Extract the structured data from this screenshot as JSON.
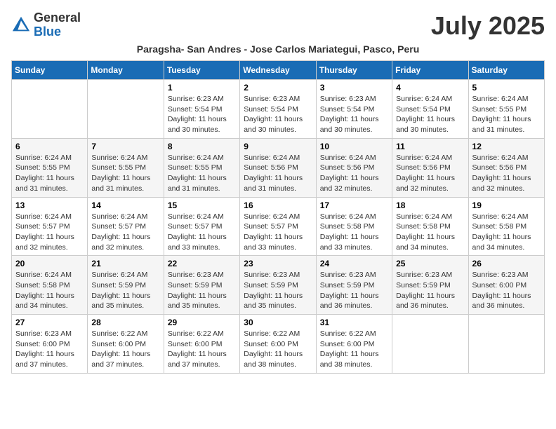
{
  "header": {
    "logo_general": "General",
    "logo_blue": "Blue",
    "month_title": "July 2025",
    "subtitle": "Paragsha- San Andres - Jose Carlos Mariategui, Pasco, Peru"
  },
  "days_of_week": [
    "Sunday",
    "Monday",
    "Tuesday",
    "Wednesday",
    "Thursday",
    "Friday",
    "Saturday"
  ],
  "weeks": [
    [
      {
        "day": "",
        "sunrise": "",
        "sunset": "",
        "daylight": ""
      },
      {
        "day": "",
        "sunrise": "",
        "sunset": "",
        "daylight": ""
      },
      {
        "day": "1",
        "sunrise": "Sunrise: 6:23 AM",
        "sunset": "Sunset: 5:54 PM",
        "daylight": "Daylight: 11 hours and 30 minutes."
      },
      {
        "day": "2",
        "sunrise": "Sunrise: 6:23 AM",
        "sunset": "Sunset: 5:54 PM",
        "daylight": "Daylight: 11 hours and 30 minutes."
      },
      {
        "day": "3",
        "sunrise": "Sunrise: 6:23 AM",
        "sunset": "Sunset: 5:54 PM",
        "daylight": "Daylight: 11 hours and 30 minutes."
      },
      {
        "day": "4",
        "sunrise": "Sunrise: 6:24 AM",
        "sunset": "Sunset: 5:54 PM",
        "daylight": "Daylight: 11 hours and 30 minutes."
      },
      {
        "day": "5",
        "sunrise": "Sunrise: 6:24 AM",
        "sunset": "Sunset: 5:55 PM",
        "daylight": "Daylight: 11 hours and 31 minutes."
      }
    ],
    [
      {
        "day": "6",
        "sunrise": "Sunrise: 6:24 AM",
        "sunset": "Sunset: 5:55 PM",
        "daylight": "Daylight: 11 hours and 31 minutes."
      },
      {
        "day": "7",
        "sunrise": "Sunrise: 6:24 AM",
        "sunset": "Sunset: 5:55 PM",
        "daylight": "Daylight: 11 hours and 31 minutes."
      },
      {
        "day": "8",
        "sunrise": "Sunrise: 6:24 AM",
        "sunset": "Sunset: 5:55 PM",
        "daylight": "Daylight: 11 hours and 31 minutes."
      },
      {
        "day": "9",
        "sunrise": "Sunrise: 6:24 AM",
        "sunset": "Sunset: 5:56 PM",
        "daylight": "Daylight: 11 hours and 31 minutes."
      },
      {
        "day": "10",
        "sunrise": "Sunrise: 6:24 AM",
        "sunset": "Sunset: 5:56 PM",
        "daylight": "Daylight: 11 hours and 32 minutes."
      },
      {
        "day": "11",
        "sunrise": "Sunrise: 6:24 AM",
        "sunset": "Sunset: 5:56 PM",
        "daylight": "Daylight: 11 hours and 32 minutes."
      },
      {
        "day": "12",
        "sunrise": "Sunrise: 6:24 AM",
        "sunset": "Sunset: 5:56 PM",
        "daylight": "Daylight: 11 hours and 32 minutes."
      }
    ],
    [
      {
        "day": "13",
        "sunrise": "Sunrise: 6:24 AM",
        "sunset": "Sunset: 5:57 PM",
        "daylight": "Daylight: 11 hours and 32 minutes."
      },
      {
        "day": "14",
        "sunrise": "Sunrise: 6:24 AM",
        "sunset": "Sunset: 5:57 PM",
        "daylight": "Daylight: 11 hours and 32 minutes."
      },
      {
        "day": "15",
        "sunrise": "Sunrise: 6:24 AM",
        "sunset": "Sunset: 5:57 PM",
        "daylight": "Daylight: 11 hours and 33 minutes."
      },
      {
        "day": "16",
        "sunrise": "Sunrise: 6:24 AM",
        "sunset": "Sunset: 5:57 PM",
        "daylight": "Daylight: 11 hours and 33 minutes."
      },
      {
        "day": "17",
        "sunrise": "Sunrise: 6:24 AM",
        "sunset": "Sunset: 5:58 PM",
        "daylight": "Daylight: 11 hours and 33 minutes."
      },
      {
        "day": "18",
        "sunrise": "Sunrise: 6:24 AM",
        "sunset": "Sunset: 5:58 PM",
        "daylight": "Daylight: 11 hours and 34 minutes."
      },
      {
        "day": "19",
        "sunrise": "Sunrise: 6:24 AM",
        "sunset": "Sunset: 5:58 PM",
        "daylight": "Daylight: 11 hours and 34 minutes."
      }
    ],
    [
      {
        "day": "20",
        "sunrise": "Sunrise: 6:24 AM",
        "sunset": "Sunset: 5:58 PM",
        "daylight": "Daylight: 11 hours and 34 minutes."
      },
      {
        "day": "21",
        "sunrise": "Sunrise: 6:24 AM",
        "sunset": "Sunset: 5:59 PM",
        "daylight": "Daylight: 11 hours and 35 minutes."
      },
      {
        "day": "22",
        "sunrise": "Sunrise: 6:23 AM",
        "sunset": "Sunset: 5:59 PM",
        "daylight": "Daylight: 11 hours and 35 minutes."
      },
      {
        "day": "23",
        "sunrise": "Sunrise: 6:23 AM",
        "sunset": "Sunset: 5:59 PM",
        "daylight": "Daylight: 11 hours and 35 minutes."
      },
      {
        "day": "24",
        "sunrise": "Sunrise: 6:23 AM",
        "sunset": "Sunset: 5:59 PM",
        "daylight": "Daylight: 11 hours and 36 minutes."
      },
      {
        "day": "25",
        "sunrise": "Sunrise: 6:23 AM",
        "sunset": "Sunset: 5:59 PM",
        "daylight": "Daylight: 11 hours and 36 minutes."
      },
      {
        "day": "26",
        "sunrise": "Sunrise: 6:23 AM",
        "sunset": "Sunset: 6:00 PM",
        "daylight": "Daylight: 11 hours and 36 minutes."
      }
    ],
    [
      {
        "day": "27",
        "sunrise": "Sunrise: 6:23 AM",
        "sunset": "Sunset: 6:00 PM",
        "daylight": "Daylight: 11 hours and 37 minutes."
      },
      {
        "day": "28",
        "sunrise": "Sunrise: 6:22 AM",
        "sunset": "Sunset: 6:00 PM",
        "daylight": "Daylight: 11 hours and 37 minutes."
      },
      {
        "day": "29",
        "sunrise": "Sunrise: 6:22 AM",
        "sunset": "Sunset: 6:00 PM",
        "daylight": "Daylight: 11 hours and 37 minutes."
      },
      {
        "day": "30",
        "sunrise": "Sunrise: 6:22 AM",
        "sunset": "Sunset: 6:00 PM",
        "daylight": "Daylight: 11 hours and 38 minutes."
      },
      {
        "day": "31",
        "sunrise": "Sunrise: 6:22 AM",
        "sunset": "Sunset: 6:00 PM",
        "daylight": "Daylight: 11 hours and 38 minutes."
      },
      {
        "day": "",
        "sunrise": "",
        "sunset": "",
        "daylight": ""
      },
      {
        "day": "",
        "sunrise": "",
        "sunset": "",
        "daylight": ""
      }
    ]
  ]
}
